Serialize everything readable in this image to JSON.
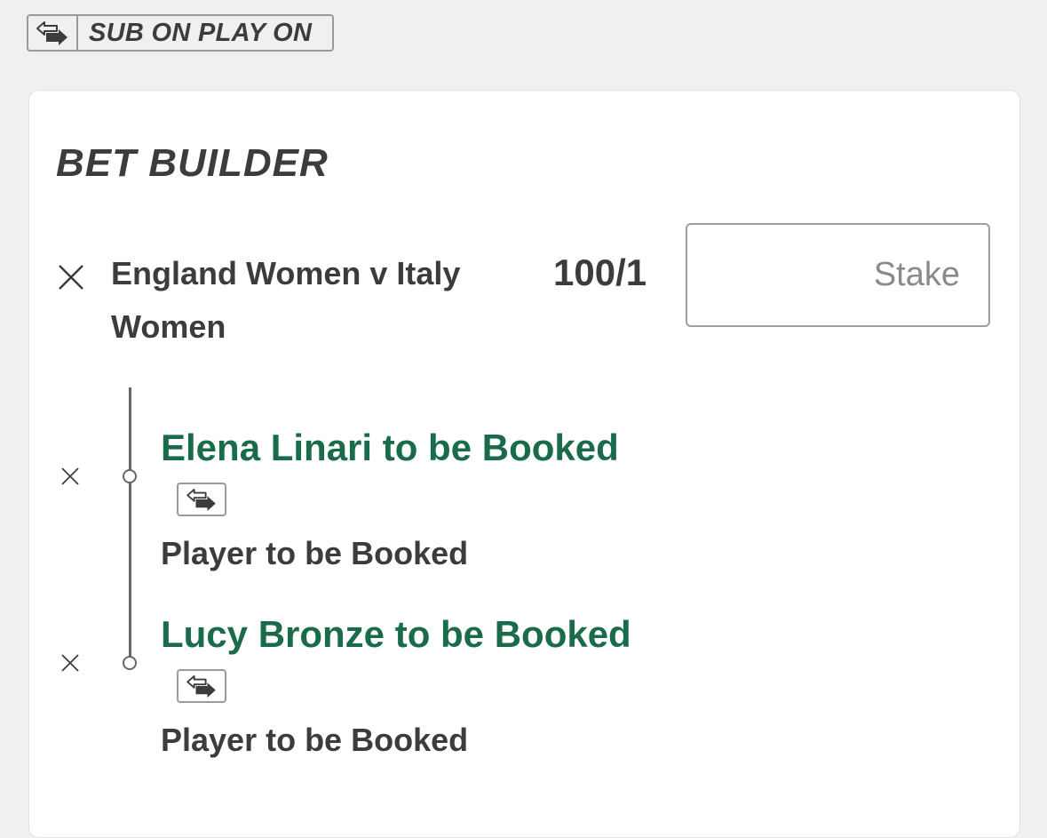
{
  "header": {
    "badge_icon": "substitution-arrows-icon",
    "badge_label": "SUB ON PLAY ON"
  },
  "bet_builder": {
    "title": "BET BUILDER",
    "event": {
      "name": "England Women v Italy Women",
      "odds": "100/1",
      "stake_placeholder": "Stake",
      "stake_value": "",
      "remove_icon": "close-icon"
    },
    "selections": [
      {
        "name": "Elena Linari to be Booked",
        "market": "Player to be Booked",
        "icon": "substitution-arrows-icon",
        "remove_icon": "close-icon"
      },
      {
        "name": "Lucy Bronze to be Booked",
        "market": "Player to be Booked",
        "icon": "substitution-arrows-icon",
        "remove_icon": "close-icon"
      }
    ]
  },
  "colors": {
    "page_background": "#f0f0f0",
    "card_background": "#ffffff",
    "selection_text": "#1a6b4a",
    "primary_text": "#3c3c3c",
    "border": "#9e9e9e"
  }
}
